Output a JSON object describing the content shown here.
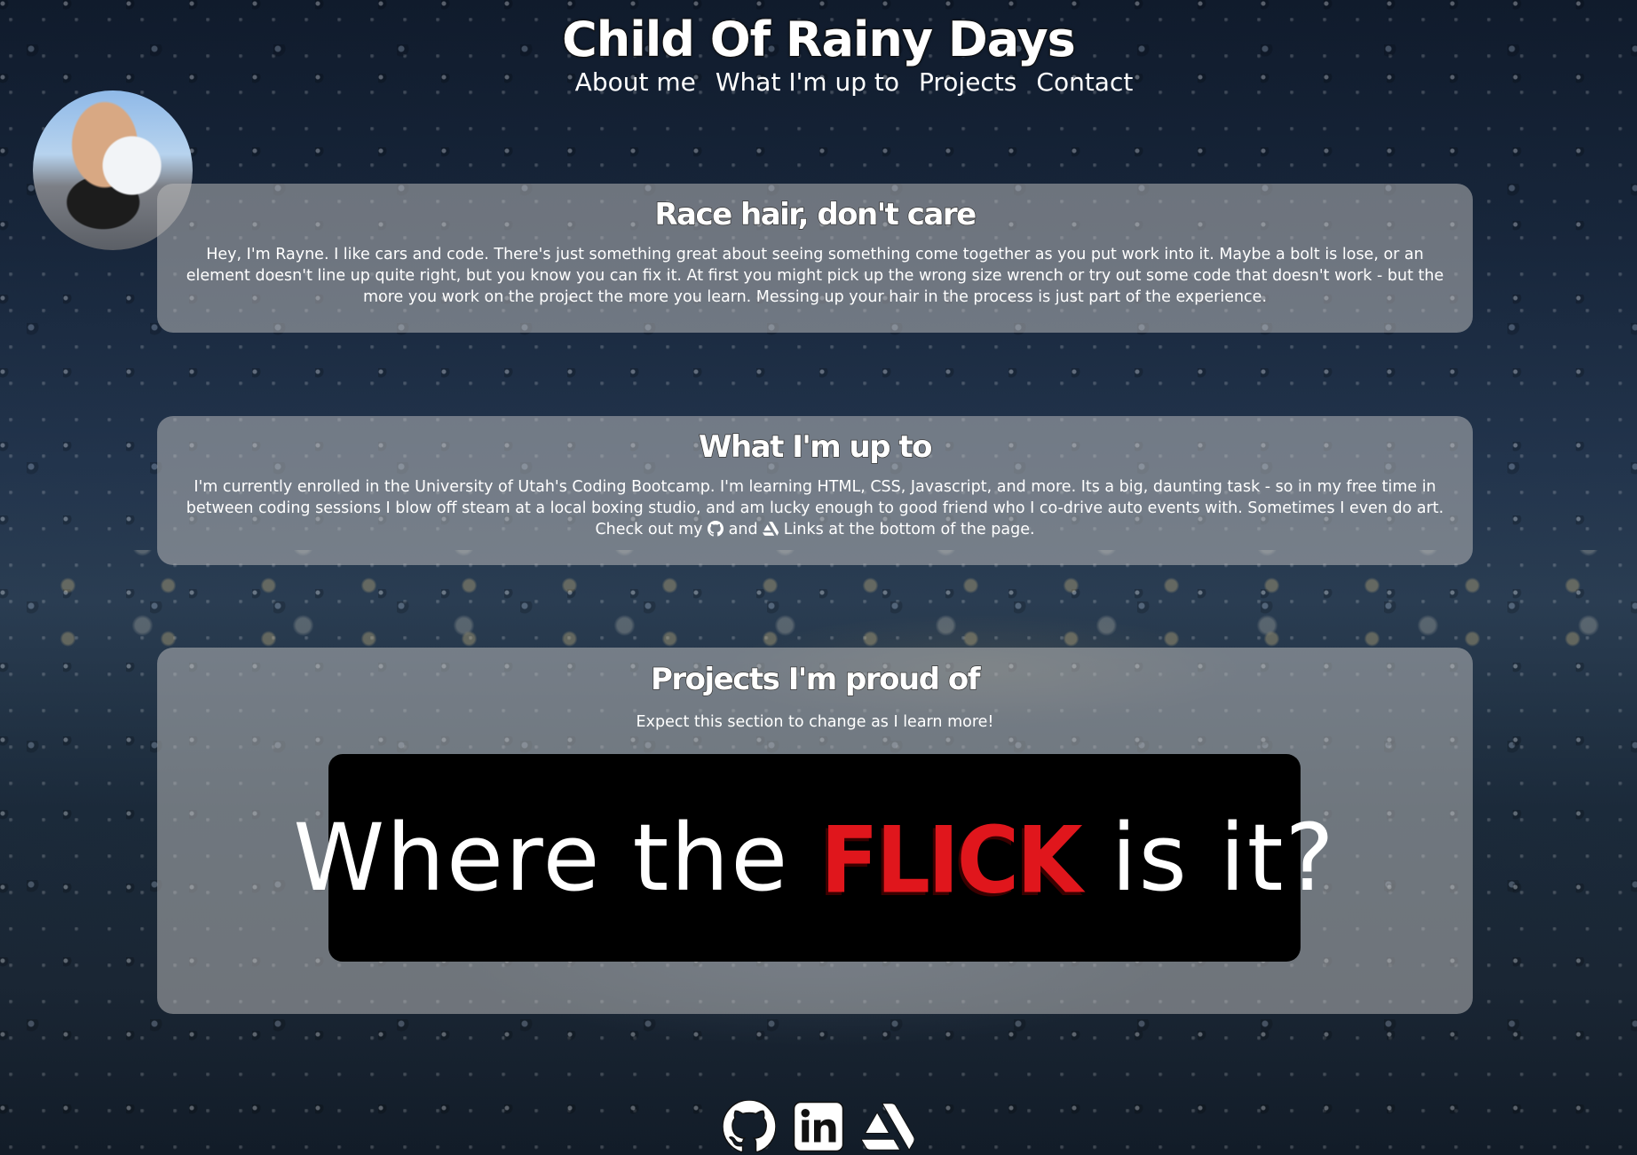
{
  "header": {
    "title": "Child Of Rainy Days",
    "nav": [
      {
        "label": "About me"
      },
      {
        "label": "What I'm up to"
      },
      {
        "label": "Projects"
      },
      {
        "label": "Contact"
      }
    ]
  },
  "about": {
    "heading": "Race hair, don't care",
    "body": "Hey, I'm Rayne. I like cars and code. There's just something great about seeing something come together as you put work into it. Maybe a bolt is lose, or an element doesn't line up quite right, but you know you can fix it. At first you might pick up the wrong size wrench or try out some code that doesn't work - but the more you work on the project the more you learn. Messing up your hair in the process is just part of the experience."
  },
  "upto": {
    "heading": "What I'm up to",
    "body_before": "I'm currently enrolled in the University of Utah's Coding Bootcamp. I'm learning HTML, CSS, Javascript, and more. Its a big, daunting task - so in my free time in between coding sessions I blow off steam at a local boxing studio, and am lucky enough to good friend who I co-drive auto events with. Sometimes I even do art. Check out my",
    "body_and": "and",
    "body_after": "Links at the bottom of the page."
  },
  "projects": {
    "heading": "Projects I'm proud of",
    "subtext": "Expect this section to change as I learn more!",
    "banner": {
      "before": "Where the",
      "highlight": "FLICK",
      "after": "is it?",
      "highlight_color": "#e0161c"
    }
  },
  "footer": {
    "icons": [
      "github-icon",
      "linkedin-icon",
      "artstation-icon"
    ]
  },
  "colors": {
    "card_bg": "rgba(190,190,190,0.52)",
    "banner_bg": "#000000",
    "text": "#ffffff"
  }
}
